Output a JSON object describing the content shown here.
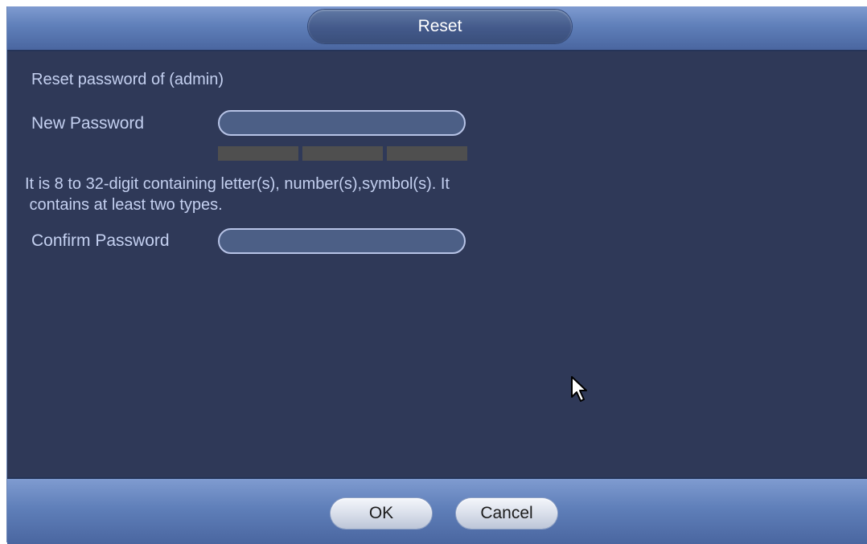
{
  "dialog": {
    "title": "Reset",
    "heading": "Reset password of (admin)",
    "new_password": {
      "label": "New Password",
      "value": "",
      "placeholder": "",
      "strength_levels": 3
    },
    "hint_line1": "It is 8 to 32-digit containing letter(s), number(s),symbol(s). It",
    "hint_line2": " contains at least two types.",
    "confirm_password": {
      "label": "Confirm Password",
      "value": "",
      "placeholder": ""
    }
  },
  "footer": {
    "ok_label": "OK",
    "cancel_label": "Cancel"
  },
  "colors": {
    "panel_bg": "#2f3958",
    "bar_accent": "#5f7fb9",
    "label_text": "#c4d0f0",
    "strength_empty": "#4f4f4f"
  },
  "icons": [
    "mouse-pointer-icon"
  ]
}
